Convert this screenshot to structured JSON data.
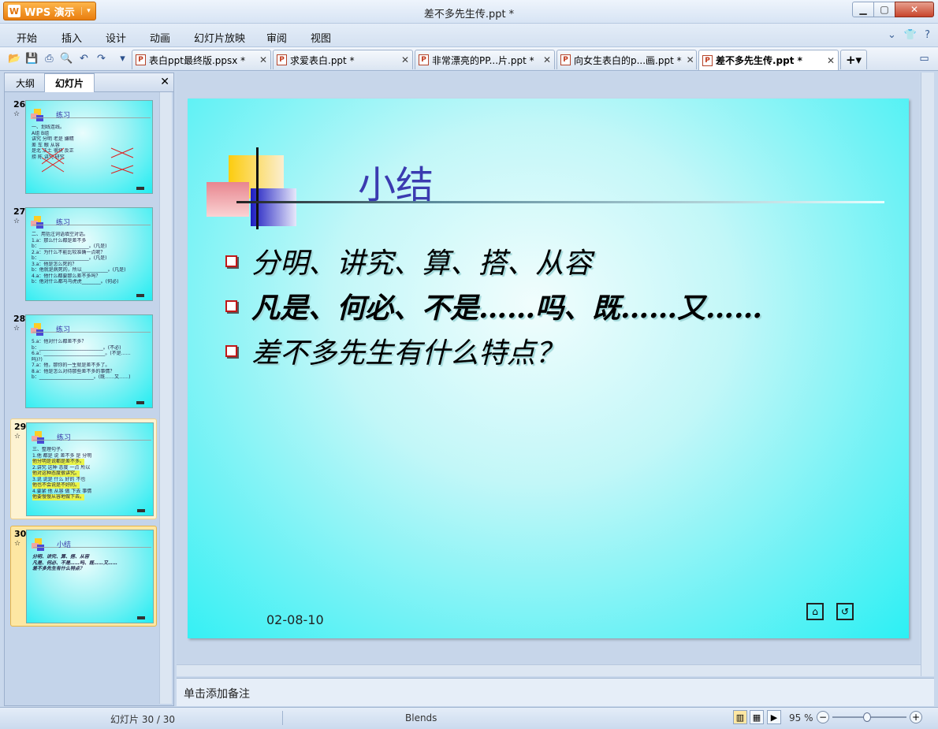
{
  "window": {
    "app_button": "WPS 演示",
    "title": "差不多先生传.ppt *"
  },
  "menu": [
    "开始",
    "插入",
    "设计",
    "动画",
    "幻灯片放映",
    "审阅",
    "视图"
  ],
  "doc_tabs": [
    {
      "label": "表白ppt最终版.ppsx *",
      "active": false
    },
    {
      "label": "求爱表白.ppt *",
      "active": false
    },
    {
      "label": "非常漂亮的PP...片.ppt *",
      "active": false
    },
    {
      "label": "向女生表白的p...画.ppt *",
      "active": false
    },
    {
      "label": "差不多先生传.ppt *",
      "active": true
    }
  ],
  "panel": {
    "tab_outline": "大纲",
    "tab_slides": "幻灯片"
  },
  "thumbnails": [
    {
      "num": "26",
      "title": "练习",
      "lines": [
        "一、划线连线。",
        "A组            B组",
        "讲究    分明    老是    嫌精",
        "差      车      眼      从容",
        "是北    法土    很快    反正",
        "捞      陈      讲究    研究"
      ]
    },
    {
      "num": "27",
      "title": "练习",
      "lines": [
        "二、用括注词语填空对话。",
        "1.a：那么什么都是差不多",
        "  b：_____________________。(凡是)",
        "2.a：为什么不能比较准确一点呢？",
        "  b：_____________________。(凡是)",
        "3.a：他是怎么死的？",
        "  b：他就是病死的，所以___________。(凡是)",
        "4.a：他什么都要那么差不多吗？",
        "  b：他对什么都马马虎虎________。(何必)"
      ]
    },
    {
      "num": "28",
      "title": "练习",
      "lines": [
        "5.a：他对什么都差不多？",
        "  b：___________________________。(不必)",
        "6.a：__________________________。(不是……",
        "  吗)?)",
        "7.a：他，那你的一生就是差不多了。",
        "8.a：他是怎么对待那些差不多的事情？",
        "  b：_______________________。(既……又……)"
      ]
    },
    {
      "num": "29",
      "title": "练习",
      "lines": [
        "三、整理句子。",
        "1.他   都是   说   差不多   是   分明",
        "  他分明是说都是差不多。",
        "2.讲究  这种  态度  一点  所以",
        "  他对这种态度很讲究。",
        "3.说   说是   什么   好的   不也",
        "  他也不会说是不好的。",
        "4.要紧  他   从容   做   下去   事情",
        "  他要慢慢从容地做下去。"
      ]
    },
    {
      "num": "30",
      "title": "小结",
      "lines": [
        "分明、讲究、算、搭、从容",
        "凡是、何必、不是……吗、既……又……",
        "差不多先生有什么特点？"
      ]
    }
  ],
  "slide": {
    "title": "小结",
    "bullets": [
      "分明、讲究、算、搭、从容",
      "凡是、何必、不是……吗、既……又……",
      "差不多先生有什么特点？"
    ],
    "date": "02-08-10"
  },
  "notes_placeholder": "单击添加备注",
  "status": {
    "slide_counter": "幻灯片 30 / 30",
    "theme": "Blends",
    "zoom": "95 %"
  },
  "icons": {
    "save": "floppy-icon",
    "undo": "undo-icon",
    "redo": "redo-icon",
    "home": "home-icon",
    "return": "return-icon"
  },
  "colors": {
    "accent": "#e97d0f",
    "slide_title": "#3b3bb0",
    "bullet_box": "#c01818"
  }
}
